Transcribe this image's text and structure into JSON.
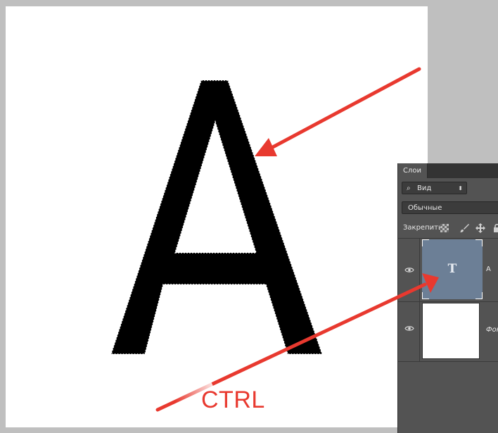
{
  "canvas": {
    "letter": "A"
  },
  "annotation": {
    "label": "CTRL",
    "color": "#e8392f"
  },
  "layers_panel": {
    "tab_label": "Слои",
    "filter": {
      "icon": "search-icon",
      "label": "Вид"
    },
    "blend_mode": "Обычные",
    "lock_label": "Закрепить:",
    "lock_icons": [
      "lock-transparent-icon",
      "lock-brush-icon",
      "lock-move-icon",
      "lock-all-icon"
    ],
    "layers": [
      {
        "name": "A",
        "type": "text",
        "visible": true,
        "selected": true
      },
      {
        "name": "Фон",
        "type": "background",
        "visible": true,
        "selected": false
      }
    ]
  }
}
